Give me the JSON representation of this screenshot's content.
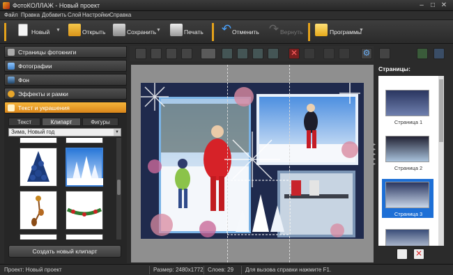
{
  "window": {
    "title": "ФотоКОЛЛАЖ - Новый проект"
  },
  "menu": [
    "Файл",
    "Правка",
    "Добавить",
    "Слой",
    "Настройки",
    "Справка"
  ],
  "toolbar": {
    "new_label": "Новый",
    "open_label": "Открыть",
    "save_label": "Сохранить",
    "print_label": "Печать",
    "undo_label": "Отменить",
    "redo_label": "Вернуть",
    "programs_label": "Программы"
  },
  "sections": [
    {
      "label": "Страницы фотокниги"
    },
    {
      "label": "Фотографии"
    },
    {
      "label": "Фон"
    },
    {
      "label": "Эффекты и рамки"
    },
    {
      "label": "Текст и украшения"
    }
  ],
  "subtabs": [
    "Текст",
    "Клипарт",
    "Фигуры"
  ],
  "clipart": {
    "category": "Зима, Новый год",
    "create_button": "Создать новый клипарт"
  },
  "pages_panel": {
    "title": "Страницы:",
    "pages": [
      "Страница 1",
      "Страница 2",
      "Страница 3"
    ],
    "selected_index": 2
  },
  "status": {
    "project": "Проект: Новый проект",
    "size": "Размер: 2480x1772",
    "layers": "Слоев: 29",
    "help": "Для вызова справки нажмите F1."
  },
  "colors": {
    "accent": "#f2a627",
    "selection": "#1d6fd6"
  }
}
